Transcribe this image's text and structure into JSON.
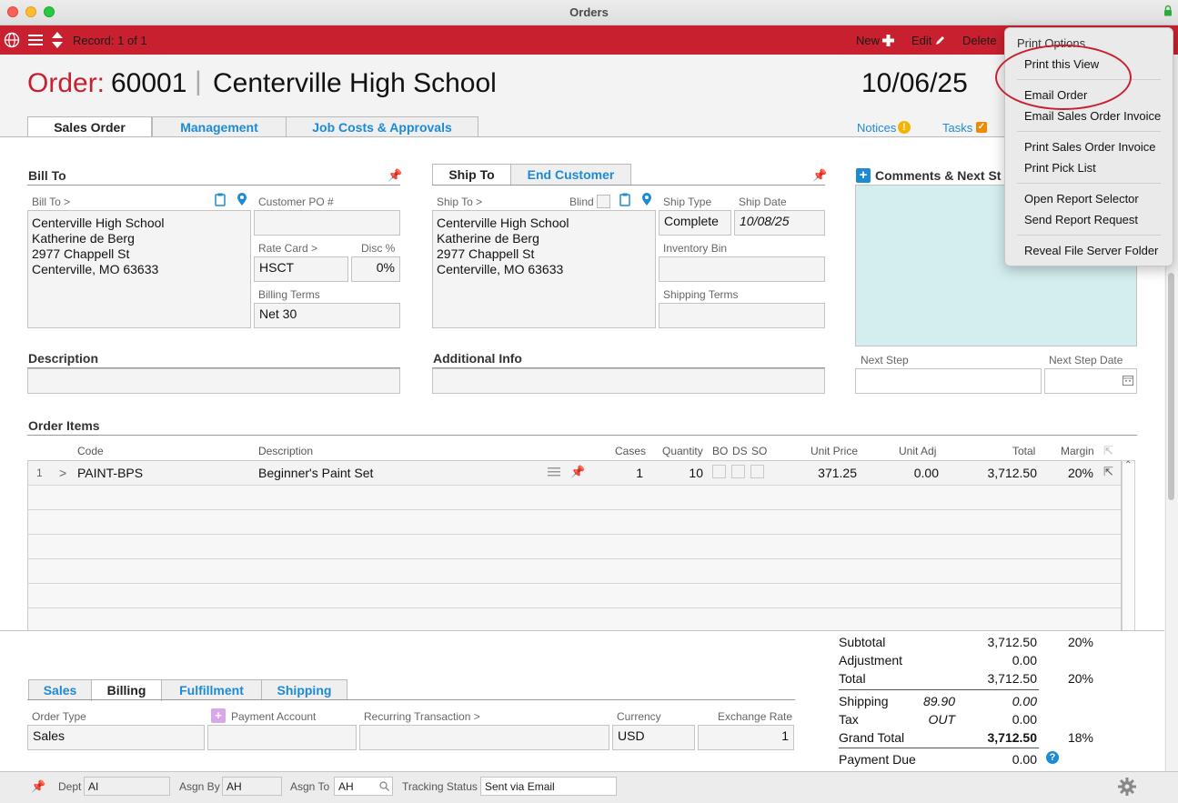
{
  "window": {
    "title": "Orders"
  },
  "toolbar": {
    "record": "Record: 1 of 1",
    "new": "New",
    "edit": "Edit",
    "delete": "Delete"
  },
  "header": {
    "order_label": "Order:",
    "order_number": "60001",
    "separator": "|",
    "customer": "Centerville High School",
    "date": "10/06/25"
  },
  "tabs": [
    "Sales Order",
    "Management",
    "Job Costs & Approvals"
  ],
  "header_links": {
    "notices": "Notices",
    "tasks": "Tasks"
  },
  "bill_to": {
    "title": "Bill To",
    "label": "Bill To >",
    "address": [
      "Centerville High School",
      "Katherine de Berg",
      "2977 Chappell St",
      "Centerville, MO 63633"
    ],
    "customer_po_label": "Customer PO #",
    "customer_po": "",
    "rate_card_label": "Rate Card >",
    "rate_card": "HSCT",
    "disc_label": "Disc %",
    "disc": "0%",
    "billing_terms_label": "Billing Terms",
    "billing_terms": "Net 30"
  },
  "ship_to": {
    "tab_ship": "Ship To",
    "tab_end": "End Customer",
    "label": "Ship To >",
    "blind_label": "Blind",
    "address": [
      "Centerville High School",
      "Katherine de Berg",
      "2977 Chappell St",
      "Centerville, MO 63633"
    ],
    "ship_type_label": "Ship Type",
    "ship_type": "Complete",
    "ship_date_label": "Ship Date",
    "ship_date": "10/08/25",
    "inventory_bin_label": "Inventory Bin",
    "shipping_terms_label": "Shipping Terms"
  },
  "comments": {
    "title": "Comments & Next St",
    "next_step_label": "Next Step",
    "next_step_date_label": "Next Step Date"
  },
  "description": {
    "title": "Description"
  },
  "additional_info": {
    "title": "Additional Info"
  },
  "order_items": {
    "title": "Order Items",
    "columns": [
      "Code",
      "Description",
      "Cases",
      "Quantity",
      "BO",
      "DS",
      "SO",
      "Unit Price",
      "Unit Adj",
      "Total",
      "Margin"
    ],
    "rows": [
      {
        "num": "1",
        "arrow": ">",
        "code": "PAINT-BPS",
        "description": "Beginner's Paint Set",
        "cases": "1",
        "quantity": "10",
        "unit_price": "371.25",
        "unit_adj": "0.00",
        "total": "3,712.50",
        "margin": "20%"
      }
    ]
  },
  "bottom_tabs": [
    "Sales",
    "Billing",
    "Fulfillment",
    "Shipping"
  ],
  "billing": {
    "order_type_label": "Order Type",
    "order_type": "Sales",
    "payment_account_label": "Payment Account",
    "recurring_label": "Recurring Transaction >",
    "currency_label": "Currency",
    "currency": "USD",
    "exchange_rate_label": "Exchange Rate",
    "exchange_rate": "1"
  },
  "totals": {
    "subtotal_label": "Subtotal",
    "subtotal": "3,712.50",
    "subtotal_margin": "20%",
    "adjustment_label": "Adjustment",
    "adjustment": "0.00",
    "total_label": "Total",
    "total": "3,712.50",
    "total_margin": "20%",
    "shipping_label": "Shipping",
    "shipping_cost": "89.90",
    "shipping": "0.00",
    "tax_label": "Tax",
    "tax_code": "OUT",
    "tax": "0.00",
    "grand_total_label": "Grand Total",
    "grand_total": "3,712.50",
    "grand_margin": "18%",
    "payment_due_label": "Payment Due",
    "payment_due": "0.00"
  },
  "status_bar": {
    "dept_label": "Dept",
    "dept": "AI",
    "asgn_by_label": "Asgn By",
    "asgn_by": "AH",
    "asgn_to_label": "Asgn To",
    "asgn_to": "AH",
    "tracking_label": "Tracking Status",
    "tracking": "Sent via Email"
  },
  "menu": {
    "header": "Print Options",
    "items": [
      "Print this View",
      "Email Order",
      "Email Sales Order Invoice",
      "Print Sales Order Invoice",
      "Print Pick List",
      "Open Report Selector",
      "Send Report Request",
      "Reveal File Server Folder"
    ]
  },
  "colors": {
    "accent": "#c8202f",
    "link": "#1d8ad6",
    "comments_bg": "#d4eeee"
  }
}
